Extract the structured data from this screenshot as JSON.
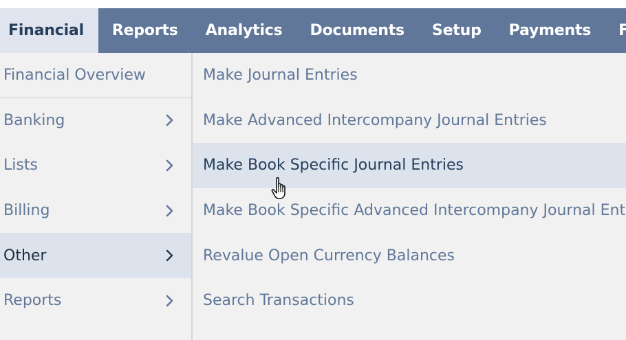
{
  "topnav": {
    "tabs": [
      {
        "label": "Financial"
      },
      {
        "label": "Reports"
      },
      {
        "label": "Analytics"
      },
      {
        "label": "Documents"
      },
      {
        "label": "Setup"
      },
      {
        "label": "Payments"
      },
      {
        "label": "Fixed"
      }
    ]
  },
  "financial_menu": {
    "items": [
      {
        "label": "Financial Overview"
      },
      {
        "label": "Banking"
      },
      {
        "label": "Lists"
      },
      {
        "label": "Billing"
      },
      {
        "label": "Other"
      },
      {
        "label": "Reports"
      }
    ]
  },
  "other_submenu": {
    "items": [
      {
        "label": "Make Journal Entries"
      },
      {
        "label": "Make Advanced Intercompany Journal Entries"
      },
      {
        "label": "Make Book Specific Journal Entries"
      },
      {
        "label": "Make Book Specific Advanced Intercompany Journal Entries"
      },
      {
        "label": "Revalue Open Currency Balances"
      },
      {
        "label": "Search Transactions"
      }
    ]
  },
  "icons": {
    "chevron": "chevron-right-icon",
    "cursor": "hand-pointer-cursor-icon"
  },
  "colors": {
    "nav_bar": "#607799",
    "active_tab": "#dfe4ee",
    "menu_bg": "#f1f1f1",
    "hover_bg": "#dde3ed",
    "link_text": "#607799",
    "dark_text": "#253e5c"
  }
}
